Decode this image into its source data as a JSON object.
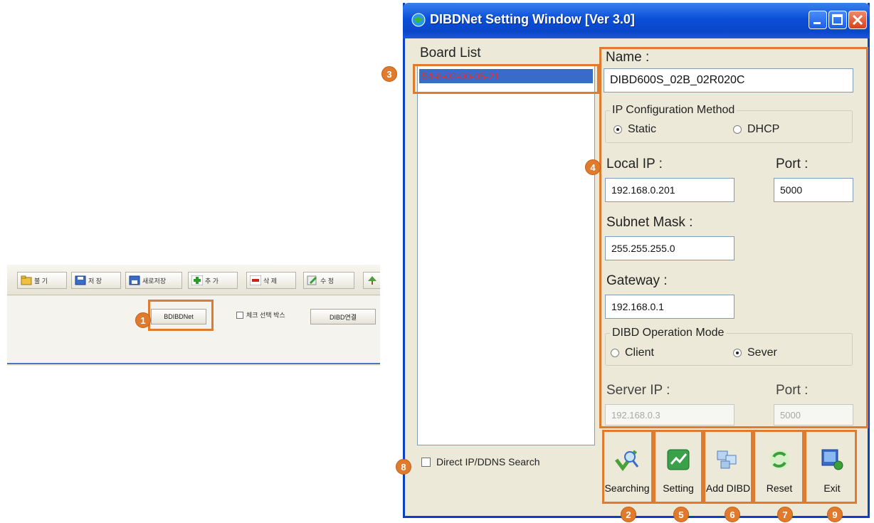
{
  "toolbar": {
    "buttons": [
      "불 기",
      "저 장",
      "새로저장",
      "추 가",
      "삭 제",
      "수 정"
    ],
    "bdibdnet_label": "BDIBDNet",
    "check_label": "체크 선택 박스",
    "dibd_connect_label": "DIBD연결"
  },
  "window": {
    "title": "DIBDNet Setting Window [Ver 3.0]"
  },
  "board_list": {
    "label": "Board List",
    "items": [
      "54-8-02-00-05-21"
    ]
  },
  "form": {
    "name_label": "Name :",
    "name_value": "DIBD600S_02B_02R020C",
    "ip_group_title": "IP Configuration Method",
    "ip_static": "Static",
    "ip_dhcp": "DHCP",
    "local_ip_label": "Local IP :",
    "local_ip_value": "192.168.0.201",
    "port_label": "Port :",
    "port_value": "5000",
    "subnet_label": "Subnet Mask :",
    "subnet_value": "255.255.255.0",
    "gateway_label": "Gateway :",
    "gateway_value": "192.168.0.1",
    "mode_group_title": "DIBD Operation Mode",
    "mode_client": "Client",
    "mode_server": "Sever",
    "server_ip_label": "Server IP :",
    "server_ip_value": "192.168.0.3",
    "server_port_label": "Port :",
    "server_port_value": "5000"
  },
  "direct_search_label": "Direct IP/DDNS Search",
  "actions": {
    "searching": "Searching",
    "setting": "Setting",
    "add_dibd": "Add DIBD",
    "reset": "Reset",
    "exit": "Exit"
  },
  "callouts": [
    "1",
    "2",
    "3",
    "4",
    "5",
    "6",
    "7",
    "8",
    "9"
  ],
  "colors": {
    "callout": "#e07a2c",
    "titlebar": "#0a4fd8",
    "selection": "#3a6bc8",
    "board_item_text": "#e03030"
  }
}
